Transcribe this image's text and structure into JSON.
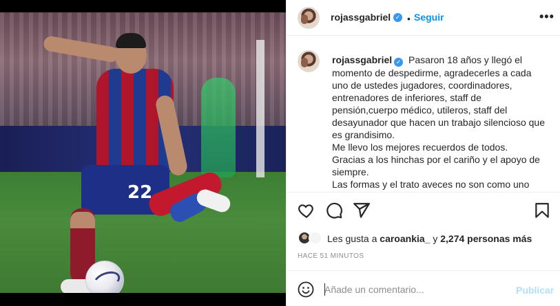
{
  "post": {
    "username": "rojassgabriel",
    "follow_label": "Seguir",
    "more_label": "•••",
    "dot": "•",
    "caption_lines": [
      "Pasaron 18 años y llegó el momento de despedirme, agradecerles a cada uno de ustedes jugadores, coordinadores, entrenadores de inferiores, staff de pensión,cuerpo médico, utileros, staff del desayunador que hacen un trabajo silencioso que es grandisimo.",
      "Me llevo los mejores recuerdos de todos.",
      "Gracias a los hinchas por el cariño y el apoyo de siempre.",
      "Las formas y el trato aveces no son como uno"
    ],
    "jersey_number": "22"
  },
  "likes": {
    "prefix": "Les gusta a ",
    "user": "caroankia_",
    "middle": " y ",
    "count": "2,274 personas más"
  },
  "timestamp": "HACE 51 MINUTOS",
  "comment": {
    "placeholder": "Añade un comentario...",
    "publish_label": "Publicar"
  },
  "colors": {
    "accent": "#0095f6",
    "publish_disabled": "#b2dffc",
    "verified": "#3897f0"
  },
  "icons": [
    "heart-icon",
    "comment-icon",
    "share-icon",
    "bookmark-icon",
    "emoji-icon",
    "verified-icon",
    "more-icon"
  ]
}
